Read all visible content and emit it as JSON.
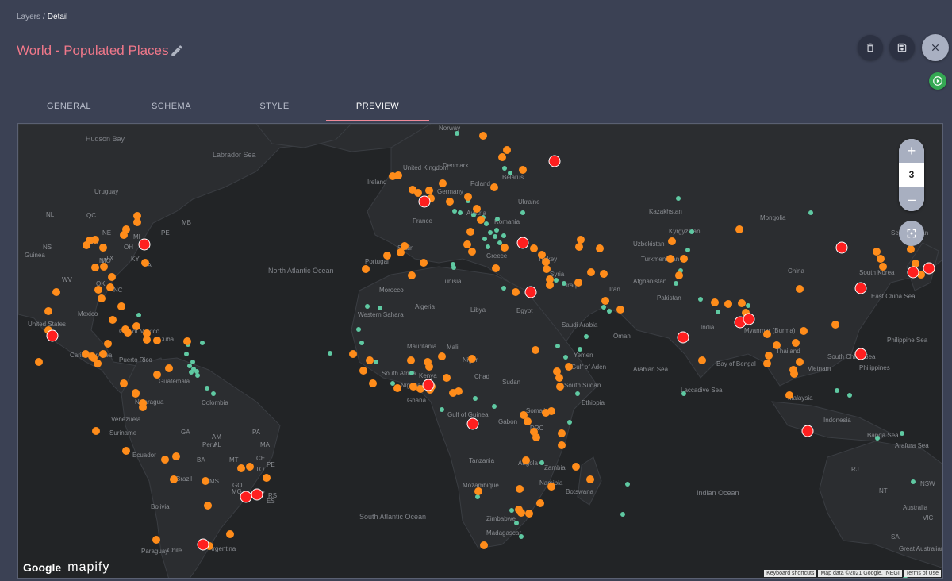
{
  "breadcrumb": {
    "parent": "Layers",
    "current": "Detail"
  },
  "title": "World - Populated Places",
  "tabs": [
    {
      "label": "GENERAL"
    },
    {
      "label": "SCHEMA"
    },
    {
      "label": "STYLE"
    },
    {
      "label": "PREVIEW",
      "active": true
    }
  ],
  "actions": {
    "delete": "trash-icon",
    "save": "save-icon",
    "close": "close-icon",
    "run": "play-icon"
  },
  "map": {
    "zoom": "3",
    "zoom_in": "+",
    "zoom_out": "–",
    "logo_google": "Google",
    "logo_mapify": "mapify",
    "attribution": [
      "Keyboard shortcuts",
      "Map data ©2021 Google, INEGI",
      "Terms of Use"
    ],
    "labels": [
      "Hudson Bay",
      "Labrador Sea",
      "North Atlantic Ocean",
      "South Atlantic Ocean",
      "Indian Ocean",
      "United Kingdom",
      "Ireland",
      "Norway",
      "Denmark",
      "Belarus",
      "Poland",
      "Germany",
      "Austria",
      "France",
      "Romania",
      "Ukraine",
      "Kazakhstan",
      "Mongolia",
      "Kyrgyzstan",
      "Uzbekistan",
      "Turkmenistan",
      "Spain",
      "Portugal",
      "Greece",
      "Turkey",
      "Syria",
      "Iraq",
      "Iran",
      "Afghanistan",
      "Pakistan",
      "China",
      "South Korea",
      "Sea of Japan",
      "East China Sea",
      "Morocco",
      "Algeria",
      "Tunisia",
      "Libya",
      "Egypt",
      "Western Sahara",
      "Saudi Arabia",
      "Oman",
      "Yemen",
      "Gulf of Aden",
      "Arabian Sea",
      "India",
      "Bay of Bengal",
      "Myanmar (Burma)",
      "Thailand",
      "Vietnam",
      "South China Sea",
      "Philippines",
      "Philippine Sea",
      "Laccadive Sea",
      "Malaysia",
      "Indonesia",
      "Banda Sea",
      "Arafura Sea",
      "Australia",
      "Great Australian Bight",
      "Mauritania",
      "Mali",
      "Niger",
      "Chad",
      "Sudan",
      "South Sudan",
      "Ethiopia",
      "Somalia",
      "Kenya",
      "Nigeria",
      "Ghana",
      "Gulf of Guinea",
      "Gabon",
      "DRC",
      "Tanzania",
      "Angola",
      "Zambia",
      "Mozambique",
      "Namibia",
      "Zimbabwe",
      "Botswana",
      "Madagascar",
      "South Africa",
      "Guinea",
      "United States",
      "Mexico",
      "Gulf of Mexico",
      "Cuba",
      "Puerto Rico",
      "Caribbean Sea",
      "Guatemala",
      "Nicaragua",
      "Venezuela",
      "Colombia",
      "Suriname",
      "Ecuador",
      "Peru",
      "Brazil",
      "Bolivia",
      "Paraguay",
      "Chile",
      "Argentina",
      "Uruguay",
      "QC",
      "NL",
      "MB",
      "PE",
      "NS",
      "NE",
      "MI",
      "NH",
      "OH",
      "NY",
      "MO",
      "PA",
      "KY",
      "WV",
      "OK",
      "NC",
      "TX",
      "GA",
      "AM",
      "PA",
      "MA",
      "CE",
      "PE",
      "AL",
      "TO",
      "BA",
      "MT",
      "GO",
      "MS",
      "MG",
      "SP",
      "RS",
      "ES",
      "RJ",
      "NT",
      "SA",
      "VIC",
      "NSW",
      "QLD"
    ]
  },
  "colors": {
    "small": "#5fc9a2",
    "medium": "#ff8c1a",
    "large": "#ff1f1f",
    "title": "#f0788a",
    "accent": "#f08a98"
  }
}
